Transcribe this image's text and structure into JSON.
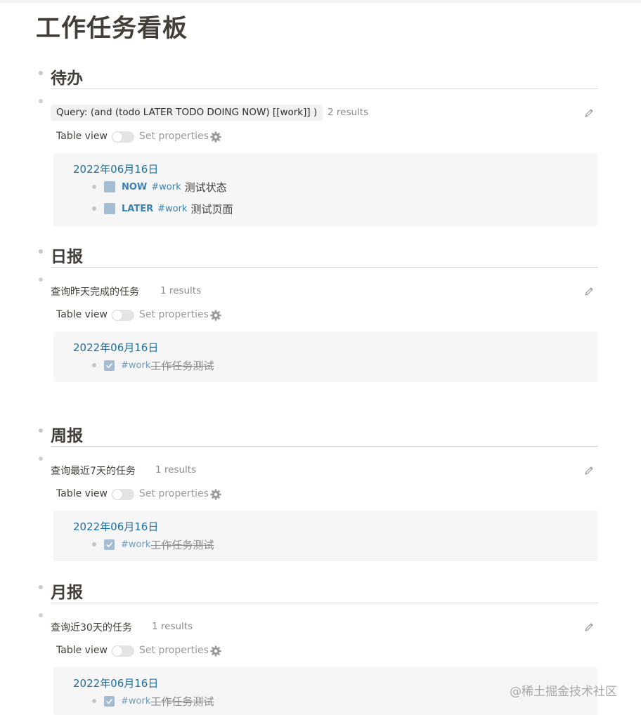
{
  "page": {
    "title": "工作任务看板"
  },
  "sections": [
    {
      "heading": "待办",
      "query": {
        "title": "Query: (and (todo LATER TODO DOING NOW) [[work]] )",
        "count": "2 results",
        "table_view_label": "Table view",
        "set_properties_label": "Set properties"
      },
      "results": {
        "date": "2022年06月16日",
        "items": [
          {
            "marker": "NOW",
            "tag": "#work",
            "text": "测试状态"
          },
          {
            "marker": "LATER",
            "tag": "#work",
            "text": "测试页面"
          }
        ]
      }
    },
    {
      "heading": "日报",
      "query": {
        "title": "查询昨天完成的任务",
        "count": "1 results",
        "table_view_label": "Table view",
        "set_properties_label": "Set properties"
      },
      "results": {
        "date": "2022年06月16日",
        "items": [
          {
            "tag": "#work",
            "text": "工作任务测试",
            "done": true
          }
        ]
      }
    },
    {
      "heading": "周报",
      "query": {
        "title": "查询最近7天的任务",
        "count": "1 results",
        "table_view_label": "Table view",
        "set_properties_label": "Set properties"
      },
      "results": {
        "date": "2022年06月16日",
        "items": [
          {
            "tag": "#work",
            "text": "工作任务测试",
            "done": true
          }
        ]
      }
    },
    {
      "heading": "月报",
      "query": {
        "title": "查询近30天的任务",
        "count": "1 results",
        "table_view_label": "Table view",
        "set_properties_label": "Set properties"
      },
      "results": {
        "date": "2022年06月16日",
        "items": [
          {
            "tag": "#work",
            "text": "工作任务测试",
            "done": true
          }
        ]
      }
    }
  ],
  "watermark": "@稀土掘金技术社区",
  "colors": {
    "link": "#1c6fa3",
    "tag": "#3b82b4",
    "checkbox": "#a5bdd3",
    "panel": "#f6f6f6"
  },
  "icons": {
    "edit": "pencil-icon",
    "settings": "gear-icon",
    "checked": "checkmark-icon"
  }
}
